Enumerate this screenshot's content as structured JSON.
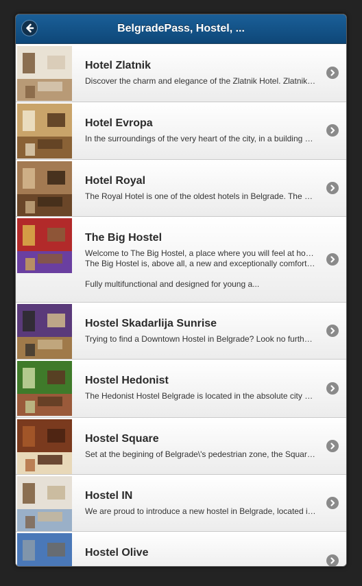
{
  "header": {
    "title": "BelgradePass, Hostel, ...",
    "back_icon": "back-arrow-icon"
  },
  "items": [
    {
      "name": "Hotel Zlatnik",
      "description": "Discover the charm and elegance of the Zlatnik Hotel. Zlatnik Hotel offers a unique stay",
      "palette": [
        "#e9e2d4",
        "#b89a76",
        "#7a5a3a",
        "#d8cbb6"
      ]
    },
    {
      "name": "Hotel Evropa",
      "description": "In the surroundings of the very heart of the city, in a building of great historical value",
      "palette": [
        "#c9a46a",
        "#8a6236",
        "#f0e6cc",
        "#5a3d22"
      ]
    },
    {
      "name": "Hotel Royal",
      "description": "The Royal Hotel is one of the oldest hotels in Belgrade. The hotel is located in the centre",
      "palette": [
        "#a37a52",
        "#6a4628",
        "#d6b98f",
        "#3e2a18"
      ]
    },
    {
      "name": "The Big Hostel",
      "description_lines": [
        "Welcome to The Big Hostel, a place where you will feel at home and meet new friends",
        "The Big Hostel is, above all, a new and exceptionally comfortable place to stay",
        "",
        "Fully multifunctional and designed for young a..."
      ],
      "palette": [
        "#b22a2a",
        "#6a3fa0",
        "#d9b24a",
        "#8a5a38"
      ]
    },
    {
      "name": "Hostel Skadarlija Sunrise",
      "description": "Trying to find a Downtown Hostel in Belgrade? Look no further than Skadarlija Sunrise",
      "palette": [
        "#5a3a7a",
        "#a07a4a",
        "#2a2a2a",
        "#c8b28a"
      ]
    },
    {
      "name": "Hostel Hedonist",
      "description": "The Hedonist Hostel Belgrade is located in the absolute city centre of Belgrade",
      "palette": [
        "#3f7a2a",
        "#9a5a3a",
        "#c8d8a0",
        "#5a3a22"
      ]
    },
    {
      "name": "Hostel Square",
      "description": "Set at the begining of Belgrade\\'s pedestrian zone, the Square hostel is ideal",
      "palette": [
        "#7a3a1e",
        "#e8d8b8",
        "#a85a2a",
        "#4a2412"
      ]
    },
    {
      "name": "Hostel IN",
      "description": "We are proud to introduce a new hostel in Belgrade, located in the city centre",
      "palette": [
        "#e6e0d6",
        "#9ab0c8",
        "#7a5a3a",
        "#c8b89a"
      ]
    },
    {
      "name": "Hostel Olive",
      "description": "",
      "palette": [
        "#4a78b8",
        "#e8e8e8",
        "#8a9aa8",
        "#6a6a6a"
      ]
    }
  ]
}
